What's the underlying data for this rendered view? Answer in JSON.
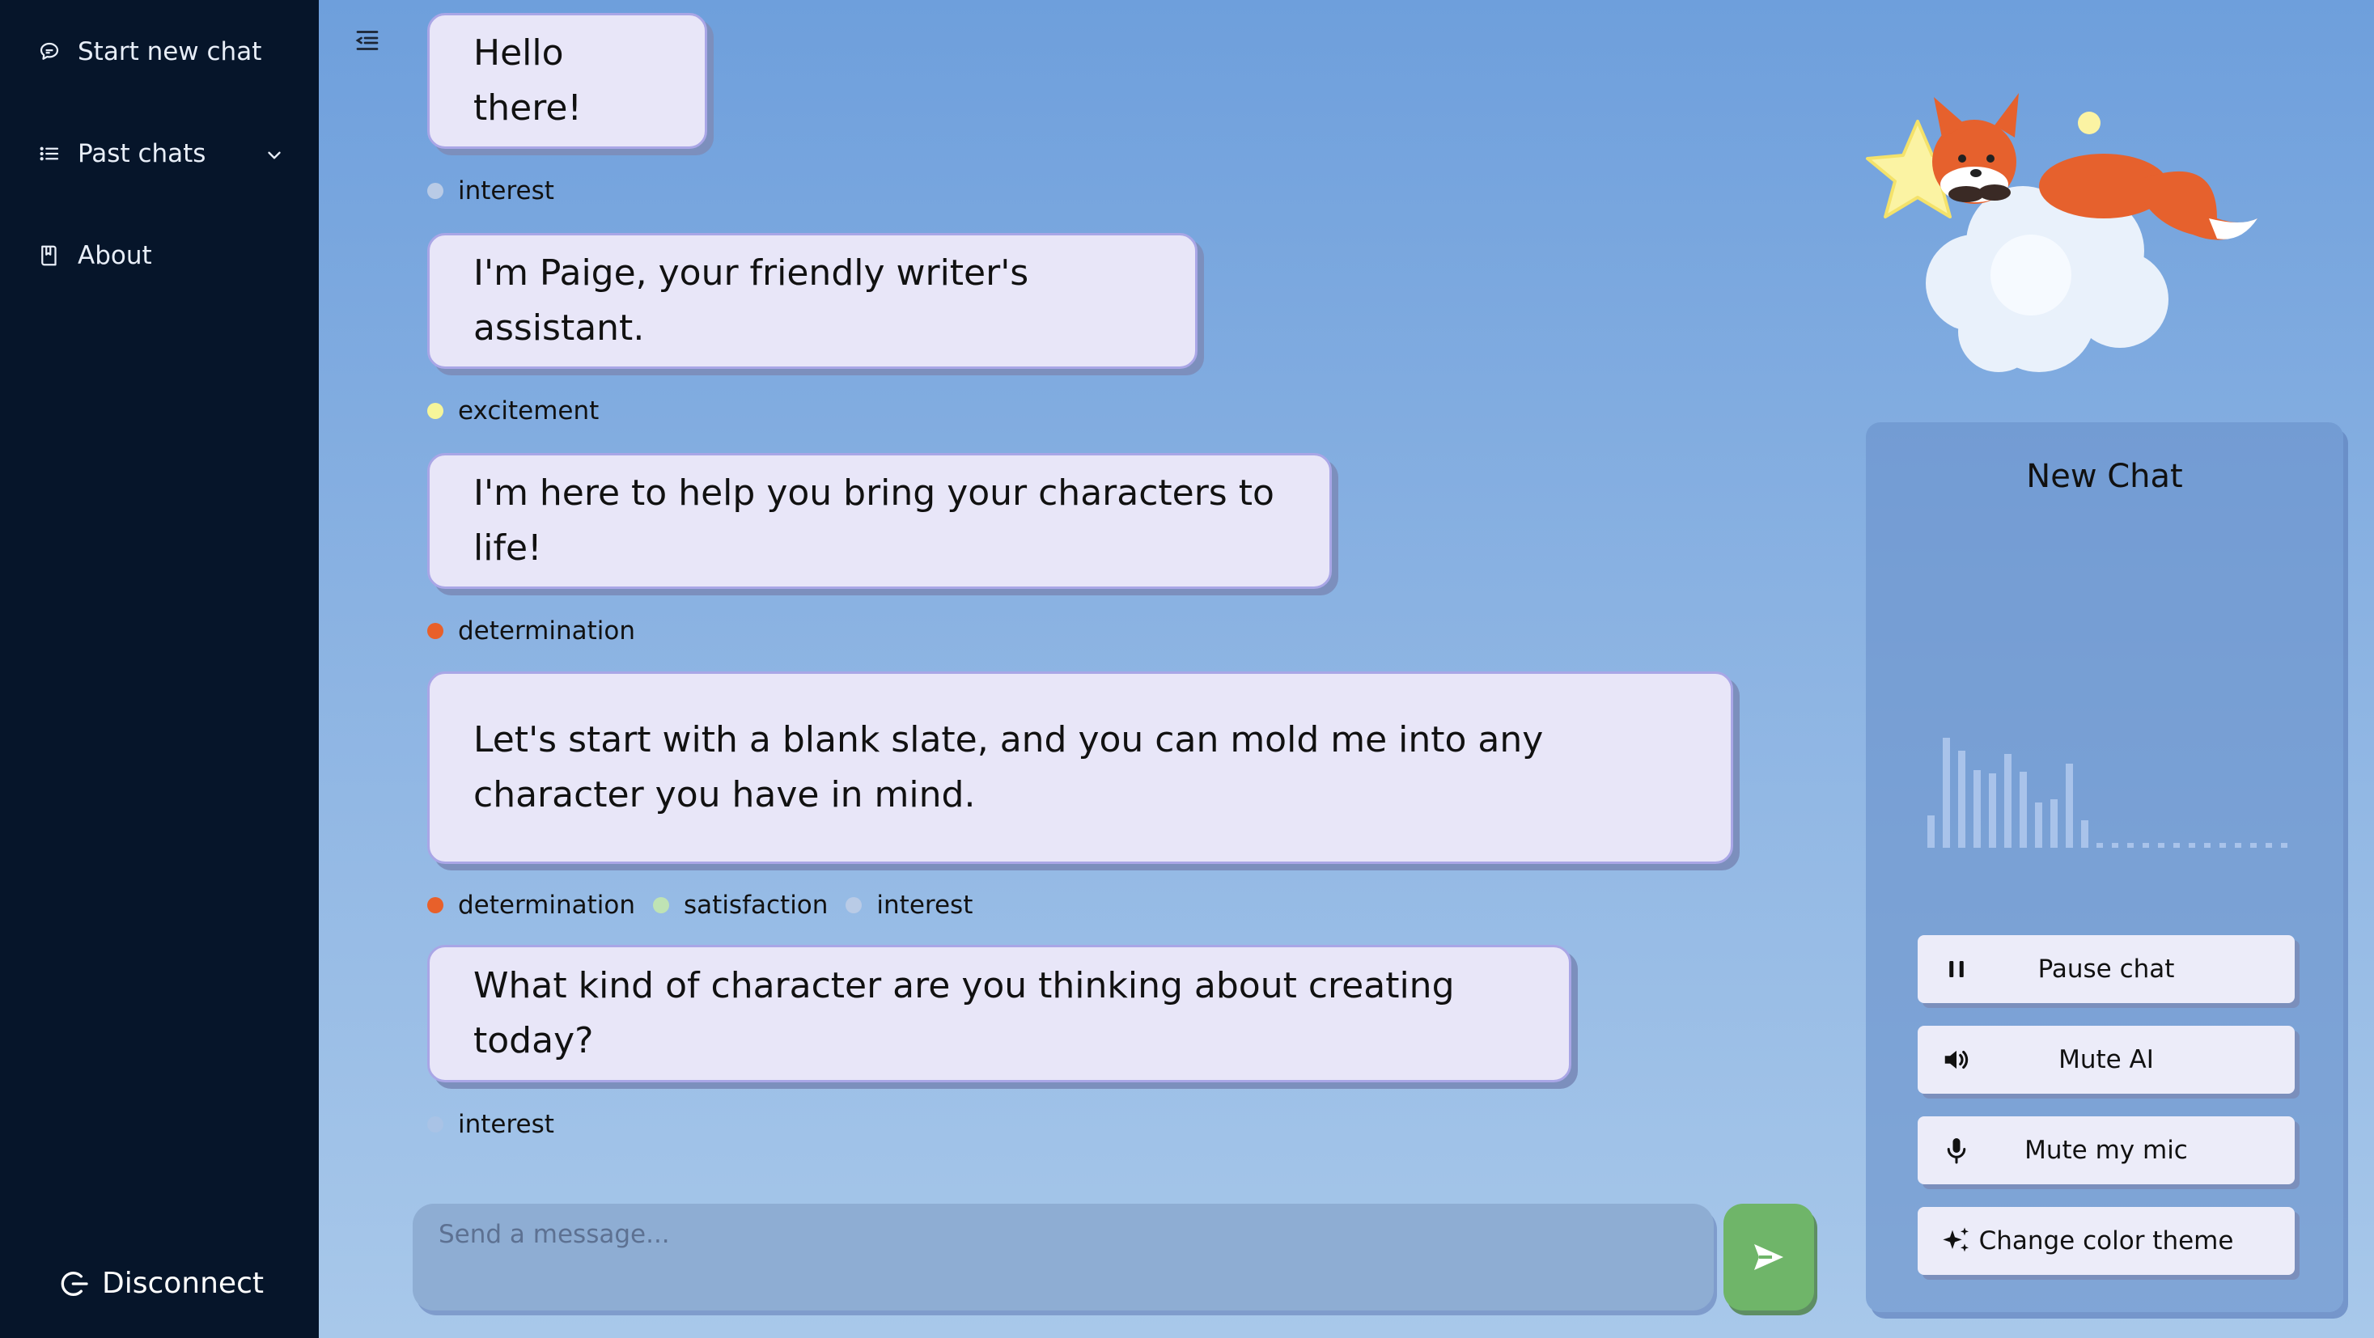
{
  "sidebar": {
    "start_new_chat": "Start new chat",
    "past_chats": "Past chats",
    "about": "About",
    "disconnect": "Disconnect"
  },
  "messages": [
    {
      "text": "Hello there!",
      "emotions": [
        {
          "label": "interest",
          "color": "#b9cbe6"
        }
      ]
    },
    {
      "text": "I'm Paige, your friendly writer's assistant.",
      "emotions": [
        {
          "label": "excitement",
          "color": "#f6f59a"
        }
      ]
    },
    {
      "text": "I'm here to help you bring your characters to life!",
      "emotions": [
        {
          "label": "determination",
          "color": "#e8602a"
        }
      ]
    },
    {
      "text": "Let's start with a blank slate, and you can mold me into any character you have in mind.",
      "emotions": [
        {
          "label": "determination",
          "color": "#e8602a"
        },
        {
          "label": "satisfaction",
          "color": "#bfe3b4"
        },
        {
          "label": "interest",
          "color": "#b9cbe6"
        }
      ]
    },
    {
      "text": "What kind of character are you thinking about creating today?",
      "emotions": [
        {
          "label": "interest",
          "color": "#a9c3e6"
        }
      ]
    }
  ],
  "input": {
    "placeholder": "Send a message..."
  },
  "panel": {
    "title": "New Chat",
    "buttons": {
      "pause": "Pause chat",
      "mute_ai": "Mute AI",
      "mute_mic": "Mute my mic",
      "theme": "Change color theme"
    }
  },
  "colors": {
    "sidebar_bg": "#06152a",
    "bubble_bg": "#e8e6f8",
    "send_button": "#6fb569"
  }
}
